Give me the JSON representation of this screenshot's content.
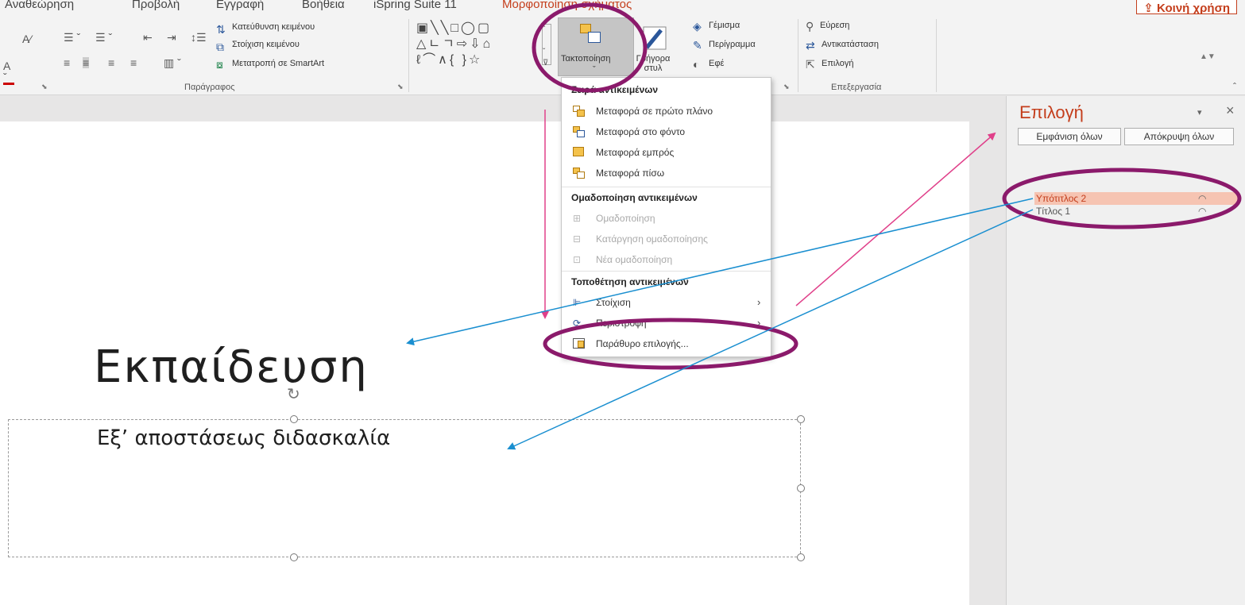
{
  "ribbon_tabs": [
    "Αναθεώρηση",
    "Προβολή",
    "Εγγραφή",
    "Βοήθεια",
    "iSpring Suite 11",
    "Μορφοποίηση σχήματος"
  ],
  "share_label": "Κοινή χρήση",
  "paragraph_group": {
    "text_direction": "Κατεύθυνση κειμένου",
    "align_text": "Στοίχιση κειμένου",
    "convert_smartart": "Μετατροπή σε SmartArt",
    "label": "Παράγραφος"
  },
  "drawing_group": {
    "arrange_label": "Τακτοποίηση",
    "quick_styles_label": "Γρήγορα στυλ",
    "fill": "Γέμισμα",
    "outline": "Περίγραμμα",
    "effects": "Εφέ"
  },
  "editing_group": {
    "find": "Εύρεση",
    "replace": "Αντικατάσταση",
    "select": "Επιλογή",
    "label": "Επεξεργασία"
  },
  "arrange_menu": {
    "order_header": "Σειρά αντικειμένων",
    "bring_to_front": "Μεταφορά σε πρώτο πλάνο",
    "send_to_back": "Μεταφορά στο φόντο",
    "bring_forward": "Μεταφορά εμπρός",
    "send_backward": "Μεταφορά πίσω",
    "group_header": "Ομαδοποίηση αντικειμένων",
    "group": "Ομαδοποίηση",
    "ungroup": "Κατάργηση ομαδοποίησης",
    "regroup": "Νέα ομαδοποίηση",
    "position_header": "Τοποθέτηση αντικειμένων",
    "align": "Στοίχιση",
    "rotate": "Περιστροφή",
    "selection_pane": "Παράθυρο επιλογής..."
  },
  "slide": {
    "title": "Εκπαίδευση",
    "subtitle": "Εξ’ αποστάσεως διδασκαλία"
  },
  "selection_pane": {
    "title": "Επιλογή",
    "show_all": "Εμφάνιση όλων",
    "hide_all": "Απόκρυψη όλων",
    "items": [
      "Υπότιτλος 2",
      "Τίτλος 1"
    ]
  },
  "colors": {
    "accent": "#c43e1c",
    "highlight_ring": "#8b1a6b",
    "annotation_blue": "#1a8fd0",
    "annotation_pink": "#e0408a"
  }
}
